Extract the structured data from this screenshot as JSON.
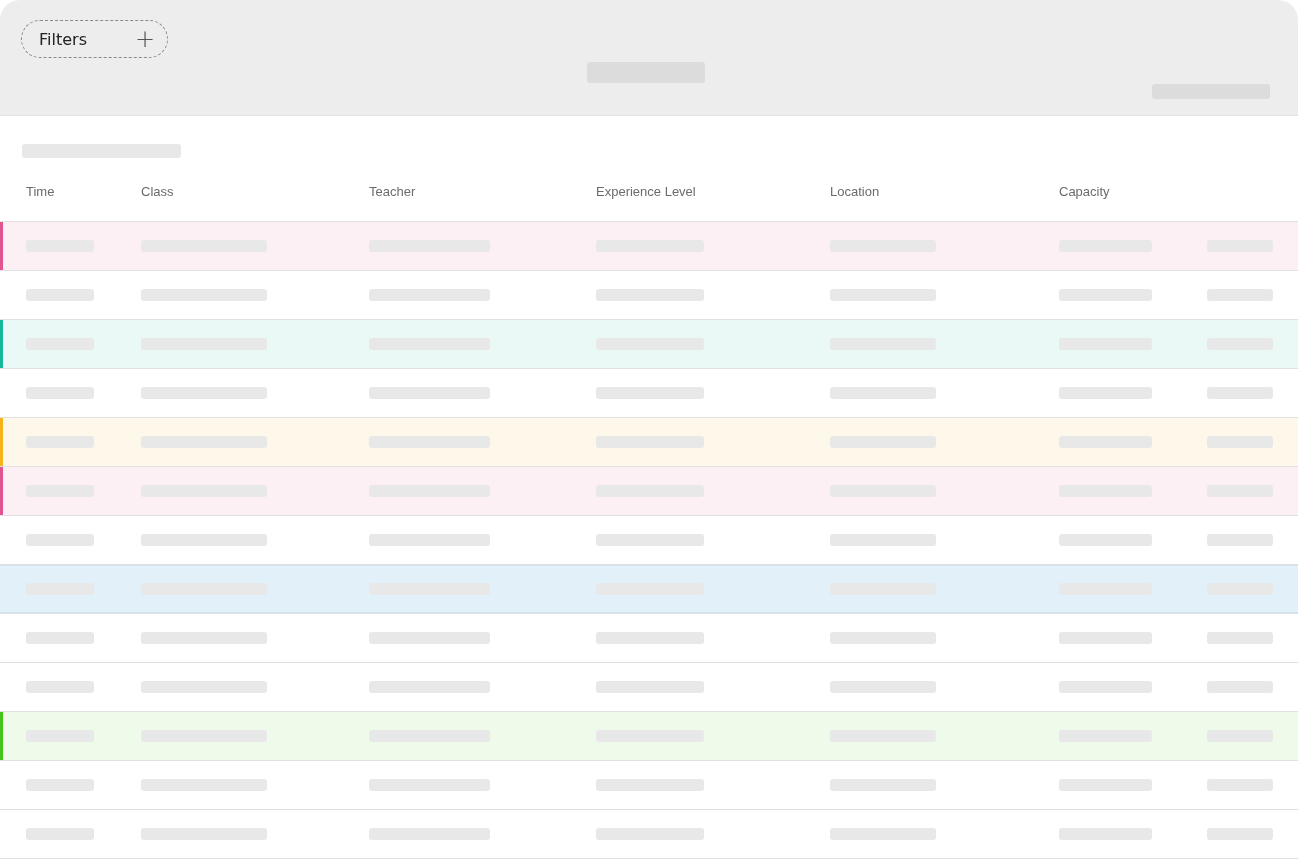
{
  "toolbar": {
    "filter_button": {
      "label": "Filters",
      "icon": "+"
    }
  },
  "table": {
    "columns": [
      "Time",
      "Class",
      "Teacher",
      "Experience Level",
      "Location",
      "Capacity"
    ],
    "rows": [
      {
        "kind": "highlighted",
        "color": "#e0558f",
        "selected": false
      },
      {
        "kind": "plain",
        "selected": false
      },
      {
        "kind": "highlighted",
        "color": "#17b69a",
        "selected": false
      },
      {
        "kind": "plain",
        "selected": false
      },
      {
        "kind": "highlighted",
        "color": "#f5b31b",
        "selected": false
      },
      {
        "kind": "highlighted",
        "color": "#e0558f",
        "selected": false
      },
      {
        "kind": "plain",
        "selected": false
      },
      {
        "kind": "plain",
        "selected": true
      },
      {
        "kind": "plain",
        "selected": false
      },
      {
        "kind": "plain",
        "selected": false
      },
      {
        "kind": "highlighted",
        "color": "#44c21a",
        "selected": false
      },
      {
        "kind": "plain",
        "selected": false
      },
      {
        "kind": "plain",
        "selected": false
      }
    ]
  }
}
